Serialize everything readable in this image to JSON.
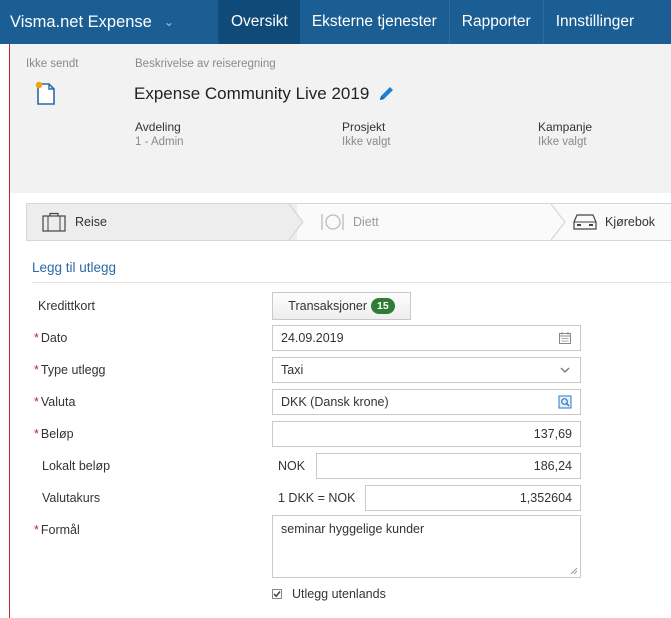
{
  "nav": {
    "app_title": "Visma.net Expense",
    "items": [
      "Oversikt",
      "Eksterne tjenester",
      "Rapporter",
      "Innstillinger"
    ]
  },
  "header": {
    "status": "Ikke sendt",
    "description_label": "Beskrivelse av reiseregning",
    "title": "Expense Community Live 2019",
    "meta": [
      {
        "key": "Avdeling",
        "value": "1 - Admin"
      },
      {
        "key": "Prosjekt",
        "value": "Ikke valgt"
      },
      {
        "key": "Kampanje",
        "value": "Ikke valgt"
      }
    ]
  },
  "steps": [
    "Reise",
    "Diett",
    "Kjørebok"
  ],
  "form": {
    "section_title": "Legg til utlegg",
    "credit_card_label": "Kredittkort",
    "transactions_button": "Transaksjoner",
    "transactions_count": "15",
    "date_label": "Dato",
    "date_value": "24.09.2019",
    "type_label": "Type utlegg",
    "type_value": "Taxi",
    "currency_label": "Valuta",
    "currency_value": "DKK (Dansk krone)",
    "amount_label": "Beløp",
    "amount_value": "137,69",
    "local_amount_label": "Lokalt beløp",
    "local_currency": "NOK",
    "local_amount_value": "186,24",
    "rate_label": "Valutakurs",
    "rate_prefix": "1 DKK = NOK",
    "rate_value": "1,352604",
    "purpose_label": "Formål",
    "purpose_value": "seminar hyggelige kunder",
    "abroad_label": "Utlegg utenlands",
    "required_mark": "*"
  },
  "colors": {
    "nav_bg": "#1a5e94",
    "nav_active": "#0f4a78",
    "accent_red": "#c8262c",
    "link_blue": "#2a6aa4",
    "badge_green": "#2f7d32"
  }
}
